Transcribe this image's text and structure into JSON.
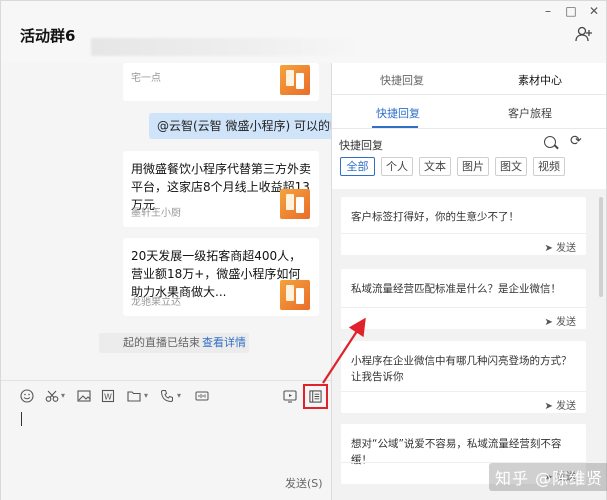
{
  "window": {
    "title": "活动群6",
    "controls": {
      "minimize": "–",
      "maximize": "□",
      "close": "✕"
    },
    "icons": {
      "add_member": "add-user-icon"
    }
  },
  "chat": {
    "top_card_source": "宅一点",
    "mention_message": "@云智(云智 微盛小程序) 可以的哈",
    "cards": [
      {
        "title": "用微盛餐饮小程序代替第三方外卖平台，这家店8个月线上收益超13万元",
        "source": "墨轩王小厨"
      },
      {
        "title": "20天发展一级拓客商超400人，营业额18万+，微盛小程序如何助力水果商做大...",
        "source": "龙驰果立达"
      }
    ],
    "notice": {
      "text": "起的直播已结束",
      "link": "查看详情"
    }
  },
  "toolbar": {
    "icons": [
      "emoji-icon",
      "scissors-icon",
      "image-icon",
      "word-doc-icon",
      "folder-icon",
      "phone-icon",
      "voice-icon",
      "live-icon",
      "quick-reply-icon"
    ]
  },
  "input": {
    "send_label": "发送(S)"
  },
  "panel": {
    "top_tabs": [
      "快捷回复",
      "素材中心"
    ],
    "sub_tabs": [
      "快捷回复",
      "客户旅程"
    ],
    "section_title": "快捷回复",
    "filters": [
      "全部",
      "个人",
      "文本",
      "图片",
      "图文",
      "视频"
    ],
    "replies": [
      {
        "text": "客户标签打得好，你的生意少不了！",
        "send": "发送"
      },
      {
        "text": "私域流量经营匹配标准是什么？是企业微信！",
        "send": "发送"
      },
      {
        "text": "小程序在企业微信中有哪几种闪亮登场的方式？让我告诉你",
        "send": "发送"
      },
      {
        "text": "想对“公域”说爱不容易，私域流量经营刻不容缓！",
        "send": "发送"
      }
    ]
  },
  "watermark": "知乎 @陈维贤",
  "colors": {
    "accent": "#2f6fc7",
    "highlight": "#e0222a",
    "mention_bg": "#cfe3f9"
  }
}
